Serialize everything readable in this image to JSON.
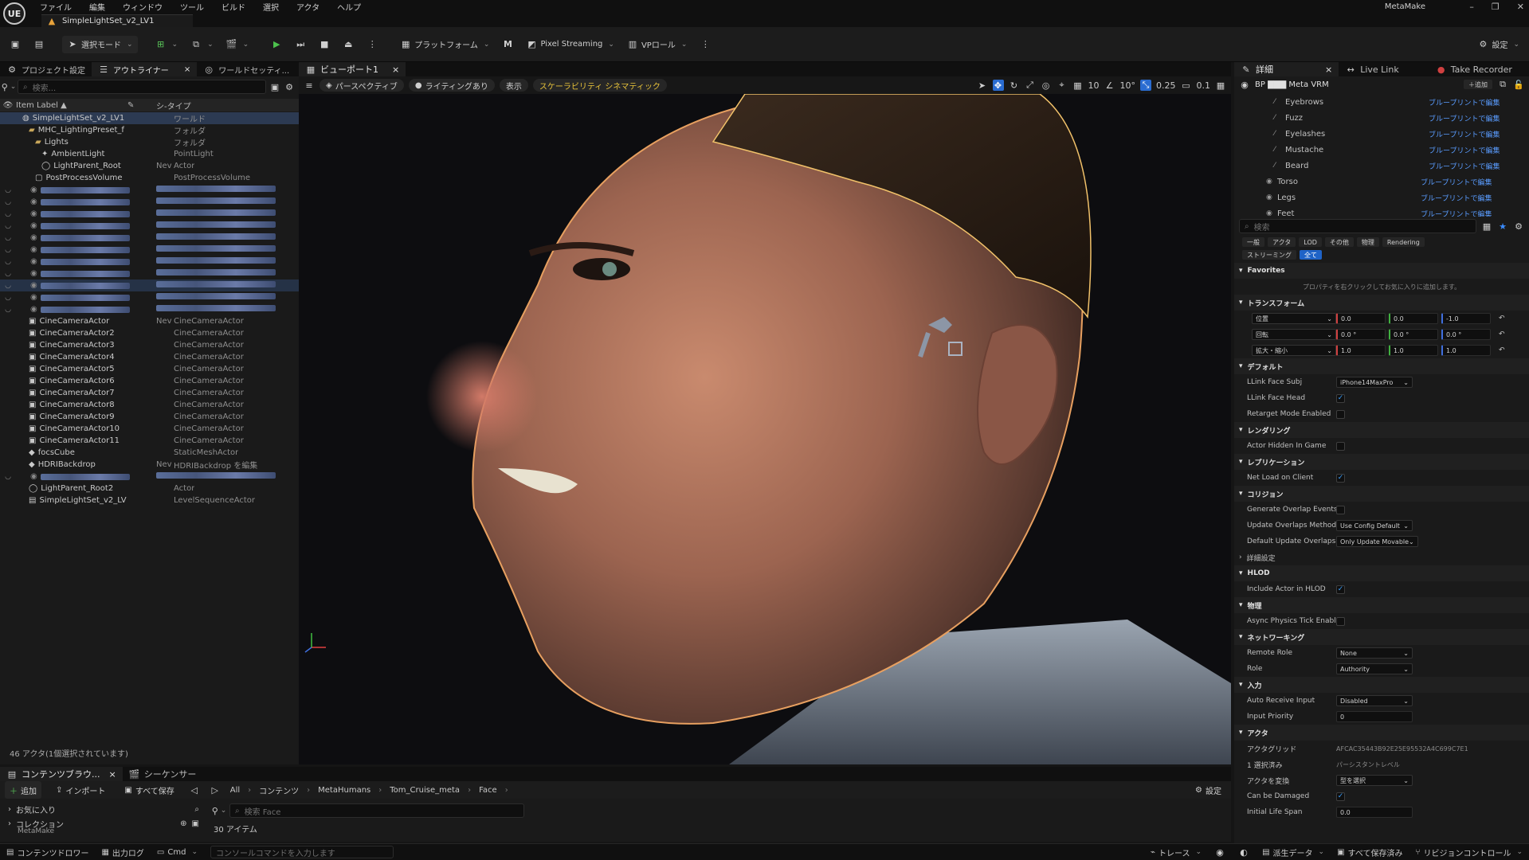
{
  "app": {
    "menu": [
      "ファイル",
      "編集",
      "ウィンドウ",
      "ツール",
      "ビルド",
      "選択",
      "アクタ",
      "ヘルプ"
    ],
    "level_tab": "SimpleLightSet_v2_LV1",
    "project": "MetaMake",
    "logo": "UE"
  },
  "window_controls": [
    "–",
    "❐",
    "✕"
  ],
  "toolbar": {
    "mode": "選択モード",
    "platform": "プラットフォーム",
    "streaming": "Pixel Streaming",
    "vp": "VPロール",
    "settings": "設定"
  },
  "left_tabs": [
    "プロジェクト設定",
    "アウトライナー",
    "ワールドセッティ..."
  ],
  "outliner": {
    "search_placeholder": "検索...",
    "col_label": "Item Label ▲",
    "col_type": "シ-タイプ",
    "rows": [
      {
        "label": "SimpleLightSet_v2_LV1",
        "type": "ワールド",
        "indent": 1,
        "icon": "world",
        "sel": true
      },
      {
        "label": "MHC_LightingPreset_f",
        "type": "フォルダ",
        "indent": 2,
        "icon": "folder"
      },
      {
        "label": "Lights",
        "type": "フォルダ",
        "indent": 3,
        "icon": "folder"
      },
      {
        "label": "AmbientLight",
        "type": "PointLight",
        "indent": 4,
        "icon": "light"
      },
      {
        "label": "LightParent_Root",
        "type": "Actor",
        "indent": 4,
        "icon": "actor",
        "prefix": "Nev"
      },
      {
        "label": "PostProcessVolume",
        "type": "PostProcessVolume",
        "indent": 3,
        "icon": "volume"
      },
      {
        "blur": true
      },
      {
        "blur": true
      },
      {
        "blur": true
      },
      {
        "blur": true
      },
      {
        "blur": true
      },
      {
        "blur": true
      },
      {
        "blur": true
      },
      {
        "blur": true
      },
      {
        "blur": true,
        "hl": true
      },
      {
        "blur": true
      },
      {
        "blur": true
      },
      {
        "label": "CineCameraActor",
        "type": "CineCameraActor",
        "indent": 2,
        "icon": "camera",
        "prefix": "Nev"
      },
      {
        "label": "CineCameraActor2",
        "type": "CineCameraActor",
        "indent": 2,
        "icon": "camera"
      },
      {
        "label": "CineCameraActor3",
        "type": "CineCameraActor",
        "indent": 2,
        "icon": "camera"
      },
      {
        "label": "CineCameraActor4",
        "type": "CineCameraActor",
        "indent": 2,
        "icon": "camera"
      },
      {
        "label": "CineCameraActor5",
        "type": "CineCameraActor",
        "indent": 2,
        "icon": "camera"
      },
      {
        "label": "CineCameraActor6",
        "type": "CineCameraActor",
        "indent": 2,
        "icon": "camera"
      },
      {
        "label": "CineCameraActor7",
        "type": "CineCameraActor",
        "indent": 2,
        "icon": "camera"
      },
      {
        "label": "CineCameraActor8",
        "type": "CineCameraActor",
        "indent": 2,
        "icon": "camera"
      },
      {
        "label": "CineCameraActor9",
        "type": "CineCameraActor",
        "indent": 2,
        "icon": "camera"
      },
      {
        "label": "CineCameraActor10",
        "type": "CineCameraActor",
        "indent": 2,
        "icon": "camera"
      },
      {
        "label": "CineCameraActor11",
        "type": "CineCameraActor",
        "indent": 2,
        "icon": "camera"
      },
      {
        "label": "focsCube",
        "type": "StaticMeshActor",
        "indent": 2,
        "icon": "mesh"
      },
      {
        "label": "HDRIBackdrop",
        "type": "HDRIBackdrop を編集",
        "indent": 2,
        "icon": "mesh",
        "prefix": "Nev",
        "link": true
      },
      {
        "blur": true
      },
      {
        "label": "LightParent_Root2",
        "type": "Actor",
        "indent": 2,
        "icon": "actor"
      },
      {
        "label": "SimpleLightSet_v2_LV",
        "type": "LevelSequenceActor",
        "indent": 2,
        "icon": "seq"
      }
    ],
    "status": "46 アクタ(1個選択されています)"
  },
  "viewport": {
    "tab": "ビューポート1",
    "perspective": "パースペクティブ",
    "lighting": "ライティングあり",
    "show": "表示",
    "scalability": "スケーラビリティ シネマティック",
    "snap": [
      "10",
      "10°",
      "0.25",
      "0.1"
    ]
  },
  "details": {
    "tabs": [
      "詳細",
      "Live Link",
      "Take Recorder"
    ],
    "actor": "BP ▇▇▇ Meta VRM",
    "add": "追加",
    "components": [
      {
        "name": "Eyebrows",
        "action": "ブループリントで編集"
      },
      {
        "name": "Fuzz",
        "action": "ブループリントで編集"
      },
      {
        "name": "Eyelashes",
        "action": "ブループリントで編集"
      },
      {
        "name": "Mustache",
        "action": "ブループリントで編集"
      },
      {
        "name": "Beard",
        "action": "ブループリントで編集"
      },
      {
        "name": "Torso",
        "action": "ブループリントで編集"
      },
      {
        "name": "Legs",
        "action": "ブループリントで編集"
      },
      {
        "name": "Feet",
        "action": "ブループリントで編集"
      }
    ],
    "search_placeholder": "検索",
    "filters": [
      "一般",
      "アクタ",
      "LOD",
      "その他",
      "物理",
      "Rendering",
      "ストリーミング",
      "全て"
    ],
    "favorites_title": "Favorites",
    "favorites_hint": "プロパティを右クリックしてお気に入りに追加します。",
    "transform_title": "トランスフォーム",
    "transform": [
      {
        "label": "位置",
        "values": [
          "0.0",
          "0.0",
          "-1.0"
        ]
      },
      {
        "label": "回転",
        "values": [
          "0.0 °",
          "0.0 °",
          "0.0 °"
        ]
      },
      {
        "label": "拡大・縮小",
        "values": [
          "1.0",
          "1.0",
          "1.0"
        ]
      }
    ],
    "sections": [
      {
        "title": "デフォルト",
        "rows": [
          {
            "k": "LLink Face Subj",
            "v": "iPhone14MaxPro",
            "t": "dd"
          },
          {
            "k": "LLink Face Head",
            "v": "✓",
            "t": "chk"
          },
          {
            "k": "Retarget Mode Enabled",
            "v": "",
            "t": "chk"
          }
        ]
      },
      {
        "title": "レンダリング",
        "rows": [
          {
            "k": "Actor Hidden In Game",
            "v": "",
            "t": "chk"
          }
        ]
      },
      {
        "title": "レプリケーション",
        "rows": [
          {
            "k": "Net Load on Client",
            "v": "✓",
            "t": "chk"
          }
        ]
      },
      {
        "title": "コリジョン",
        "rows": [
          {
            "k": "Generate Overlap Events Du...",
            "v": "",
            "t": "chk"
          },
          {
            "k": "Update Overlaps Method Du...",
            "v": "Use Config Default",
            "t": "dd"
          },
          {
            "k": "Default Update Overlaps Me...",
            "v": "Only Update Movable",
            "t": "dd"
          },
          {
            "k": "詳細設定",
            "v": "",
            "t": "sub"
          }
        ]
      },
      {
        "title": "HLOD",
        "rows": [
          {
            "k": "Include Actor in HLOD",
            "v": "✓",
            "t": "chk"
          }
        ]
      },
      {
        "title": "物理",
        "rows": [
          {
            "k": "Async Physics Tick Enabled",
            "v": "",
            "t": "chk"
          }
        ]
      },
      {
        "title": "ネットワーキング",
        "rows": [
          {
            "k": "Remote Role",
            "v": "None",
            "t": "dd"
          },
          {
            "k": "Role",
            "v": "Authority",
            "t": "dd"
          }
        ]
      },
      {
        "title": "入力",
        "rows": [
          {
            "k": "Auto Receive Input",
            "v": "Disabled",
            "t": "dd"
          },
          {
            "k": "Input Priority",
            "v": "0",
            "t": "num"
          }
        ]
      },
      {
        "title": "アクタ",
        "rows": [
          {
            "k": "アクタグリッド",
            "v": "AFCAC35443B92E25E95532A4C699C7E1",
            "t": "txt"
          },
          {
            "k": "1 選択済み",
            "v": "パーシスタントレベル",
            "t": "txt"
          },
          {
            "k": "アクタを変換",
            "v": "型を選択",
            "t": "dd"
          },
          {
            "k": "Can be Damaged",
            "v": "✓",
            "t": "chk"
          },
          {
            "k": "Initial Life Span",
            "v": "0.0",
            "t": "num"
          }
        ]
      }
    ]
  },
  "content": {
    "tabs": [
      "コンテンツブラウ...",
      "シーケンサー"
    ],
    "add": "追加",
    "import": "インポート",
    "save_all": "すべて保存",
    "breadcrumb": [
      "All",
      "コンテンツ",
      "MetaHumans",
      "Tom_Cruise_meta",
      "Face"
    ],
    "settings": "設定",
    "favorites": "お気に入り",
    "collections": "コレクション",
    "metamake": "MetaMake",
    "search_placeholder": "検索 Face",
    "count": "30 アイテム"
  },
  "statusbar": {
    "drawer": "コンテンツドロワー",
    "log": "出力ログ",
    "cmd": "Cmd",
    "cmd_placeholder": "コンソールコマンドを入力します",
    "trace": "トレース",
    "derived": "派生データ",
    "save": "すべて保存済み",
    "revision": "リビジョンコントロール"
  }
}
